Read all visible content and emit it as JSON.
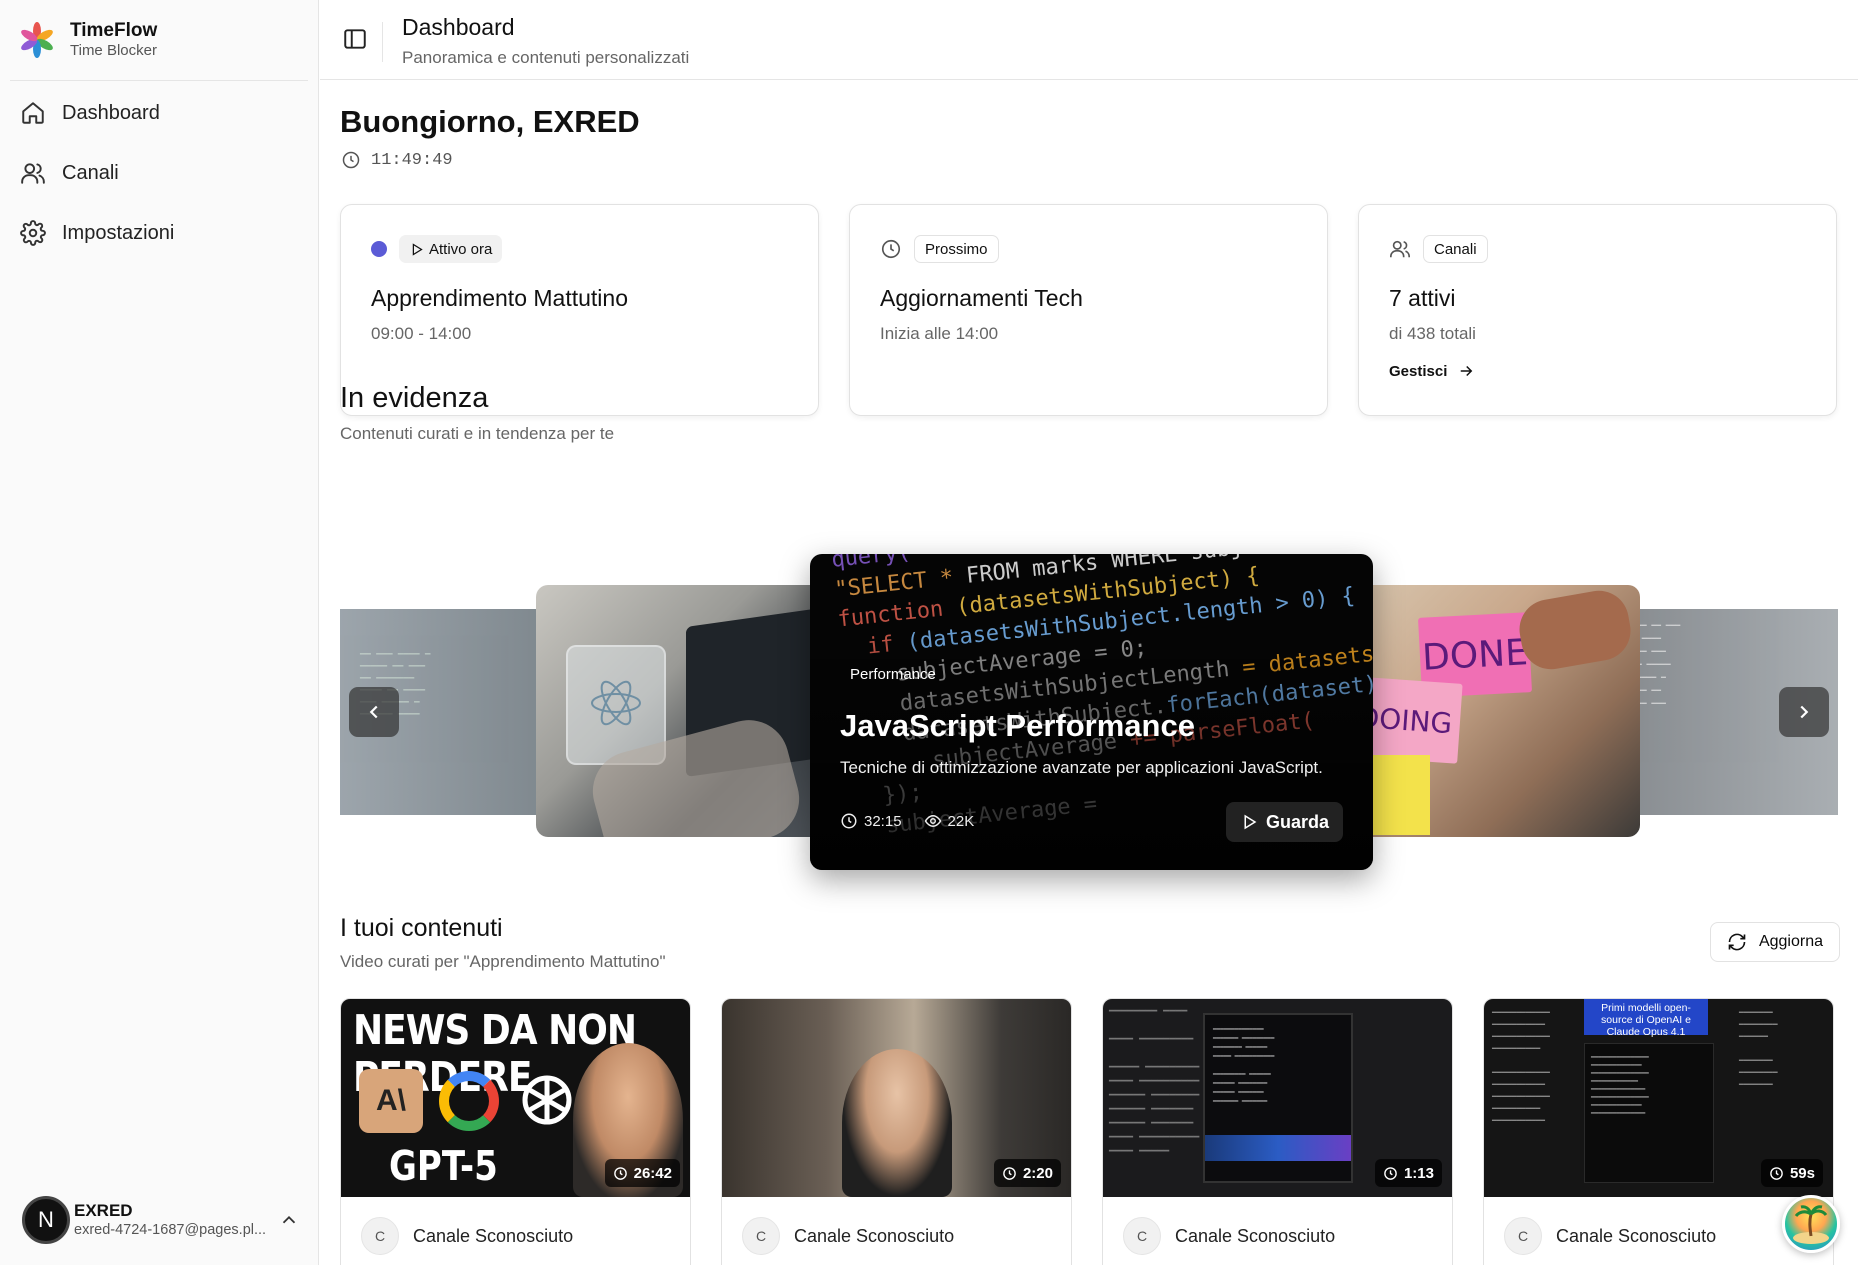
{
  "app": {
    "name": "TimeFlow",
    "subtitle": "Time Blocker"
  },
  "sidebar": {
    "items": [
      {
        "label": "Dashboard",
        "icon": "home-icon"
      },
      {
        "label": "Canali",
        "icon": "users-icon"
      },
      {
        "label": "Impostazioni",
        "icon": "gear-icon"
      }
    ],
    "user": {
      "initial": "N",
      "name": "EXRED",
      "email": "exred-4724-1687@pages.pl..."
    }
  },
  "header": {
    "title": "Dashboard",
    "subtitle": "Panoramica e contenuti personalizzati"
  },
  "greeting": {
    "text": "Buongiorno, EXRED",
    "time": "11:49:49"
  },
  "cards": {
    "active": {
      "badge": "Attivo ora",
      "title": "Apprendimento Mattutino",
      "sub": "09:00 - 14:00",
      "dot_color": "#5b5bd6"
    },
    "next": {
      "badge": "Prossimo",
      "title": "Aggiornamenti Tech",
      "sub": "Inizia alle 14:00"
    },
    "channels": {
      "badge": "Canali",
      "title": "7 attivi",
      "sub": "di 438 totali",
      "link": "Gestisci"
    }
  },
  "featured": {
    "title": "In evidenza",
    "subtitle": "Contenuti curati e in tendenza per te",
    "slide": {
      "category": "Performance",
      "title": "JavaScript Performance",
      "description": "Tecniche di ottimizzazione avanzate per applicazioni JavaScript.",
      "duration": "32:15",
      "views": "22K",
      "cta": "Guarda"
    },
    "right_slide_notes": [
      "DONE",
      "DOING"
    ]
  },
  "content": {
    "title": "I tuoi contenuti",
    "subtitle": "Video curati per \"Apprendimento Mattutino\"",
    "refresh_label": "Aggiorna",
    "videos": [
      {
        "duration": "26:42",
        "channel_initial": "C",
        "channel": "Canale Sconosciuto",
        "thumb_title": "NEWS DA NON PERDERE",
        "thumb_caption": "GPT-5"
      },
      {
        "duration": "2:20",
        "channel_initial": "C",
        "channel": "Canale Sconosciuto"
      },
      {
        "duration": "1:13",
        "channel_initial": "C",
        "channel": "Canale Sconosciuto"
      },
      {
        "duration": "59s",
        "channel_initial": "C",
        "channel": "Canale Sconosciuto",
        "thumb_title": "Primi modelli open-source di OpenAI e Claude Opus 4.1"
      }
    ]
  }
}
